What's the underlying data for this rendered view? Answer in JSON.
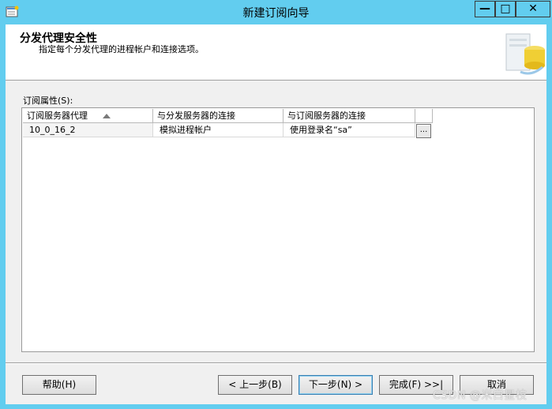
{
  "window": {
    "title": "新建订阅向导"
  },
  "titlebar_buttons": {
    "minimize": "—",
    "maximize": "□",
    "close": "✕"
  },
  "header": {
    "title": "分发代理安全性",
    "subtitle": "指定每个分发代理的进程帐户和连接选项。"
  },
  "properties_label": "订阅属性(S):",
  "grid": {
    "columns": [
      "订阅服务器代理",
      "与分发服务器的连接",
      "与订阅服务器的连接"
    ],
    "rows": [
      {
        "agent": "10_0_16_2",
        "distributor_connection": "模拟进程帐户",
        "subscriber_connection": "使用登录名“sa”",
        "button": "..."
      }
    ]
  },
  "buttons": {
    "help": "帮助(H)",
    "prev": "< 上一步(B)",
    "next": "下一步(N) >",
    "finish": "完成(F) >>|",
    "cancel": "取消"
  },
  "watermark": "CSDN @米白星枝",
  "colors": {
    "titlebar": "#62cdef",
    "client": "#f0f0f0",
    "header": "#ffffff"
  }
}
